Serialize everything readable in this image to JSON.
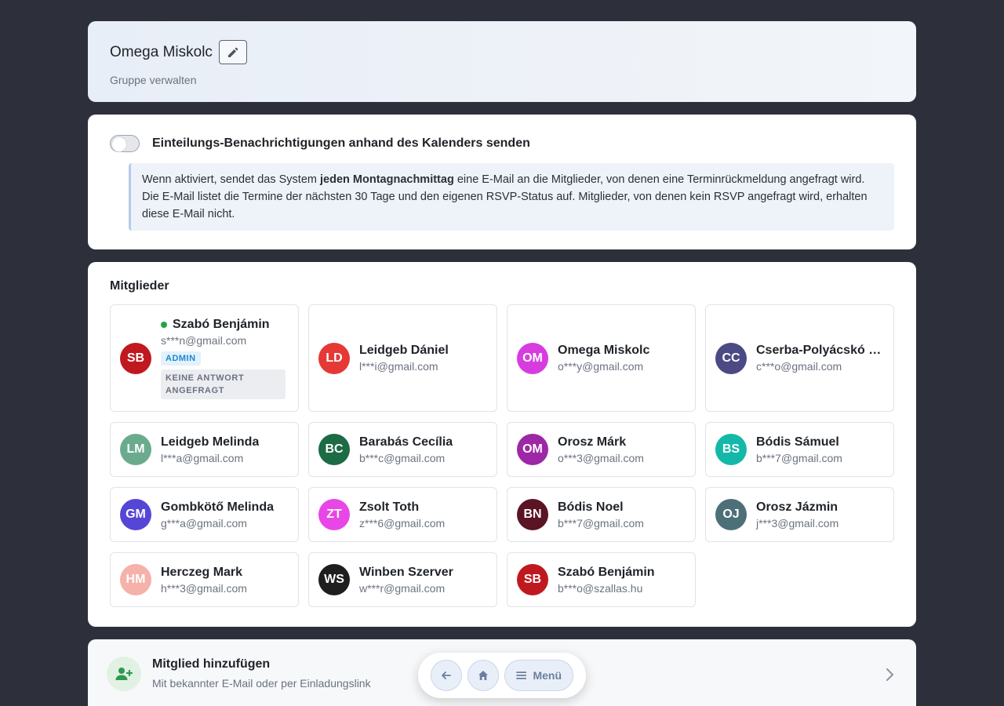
{
  "group": {
    "title": "Omega Miskolc",
    "subtitle": "Gruppe verwalten"
  },
  "notifications": {
    "toggle_label": "Einteilungs-Benachrichtigungen anhand des Kalenders senden",
    "toggle_on": false,
    "info_part1": "Wenn aktiviert, sendet das System ",
    "info_bold": "jeden Montagnachmittag",
    "info_part2": " eine E-Mail an die Mitglieder, von denen eine Terminrückmeldung angefragt wird. Die E-Mail listet die Termine der nächsten 30 Tage und den eigenen RSVP-Status auf. Mitglieder, von denen kein RSVP angefragt wird, erhalten diese E-Mail nicht."
  },
  "members_section": {
    "title": "Mitglieder",
    "members": [
      {
        "initials": "SB",
        "name": "Szabó Benjámin",
        "email": "s***n@gmail.com",
        "color": "#c0181f",
        "online": true,
        "admin_badge": "ADMIN",
        "status_badge": "KEINE ANTWORT ANGEFRAGT"
      },
      {
        "initials": "LD",
        "name": "Leidgeb Dániel",
        "email": "l***i@gmail.com",
        "color": "#e53935"
      },
      {
        "initials": "OM",
        "name": "Omega Miskolc",
        "email": "o***y@gmail.com",
        "color": "#d63ce0"
      },
      {
        "initials": "CC",
        "name": "Cserba-Polyácskó Csilla",
        "email": "c***o@gmail.com",
        "color": "#4b4a85"
      },
      {
        "initials": "LM",
        "name": "Leidgeb Melinda",
        "email": "l***a@gmail.com",
        "color": "#6aab8e"
      },
      {
        "initials": "BC",
        "name": "Barabás Cecília",
        "email": "b***c@gmail.com",
        "color": "#1d6b45"
      },
      {
        "initials": "OM",
        "name": "Orosz Márk",
        "email": "o***3@gmail.com",
        "color": "#9d27a6"
      },
      {
        "initials": "BS",
        "name": "Bódis Sámuel",
        "email": "b***7@gmail.com",
        "color": "#14b8a8"
      },
      {
        "initials": "GM",
        "name": "Gombkötő Melinda",
        "email": "g***a@gmail.com",
        "color": "#5546d6"
      },
      {
        "initials": "ZT",
        "name": "Zsolt Toth",
        "email": "z***6@gmail.com",
        "color": "#e846e6"
      },
      {
        "initials": "BN",
        "name": "Bódis Noel",
        "email": "b***7@gmail.com",
        "color": "#5a1424"
      },
      {
        "initials": "OJ",
        "name": "Orosz Jázmin",
        "email": "j***3@gmail.com",
        "color": "#4d6f78"
      },
      {
        "initials": "HM",
        "name": "Herczeg Mark",
        "email": "h***3@gmail.com",
        "color": "#f5b1aa"
      },
      {
        "initials": "WS",
        "name": "Winben Szerver",
        "email": "w***r@gmail.com",
        "color": "#1e1e1e"
      },
      {
        "initials": "SB",
        "name": "Szabó Benjámin",
        "email": "b***o@szallas.hu",
        "color": "#c0181f"
      }
    ]
  },
  "add_member": {
    "title": "Mitglied hinzufügen",
    "subtitle": "Mit bekannter E-Mail oder per Einladungslink"
  },
  "nav": {
    "menu_label": "Menü"
  },
  "icons": {
    "edit": "pencil-icon",
    "add": "user-plus-icon",
    "chevron": "chevron-right-icon",
    "back": "arrow-left-icon",
    "home": "home-icon",
    "menu": "menu-icon"
  }
}
